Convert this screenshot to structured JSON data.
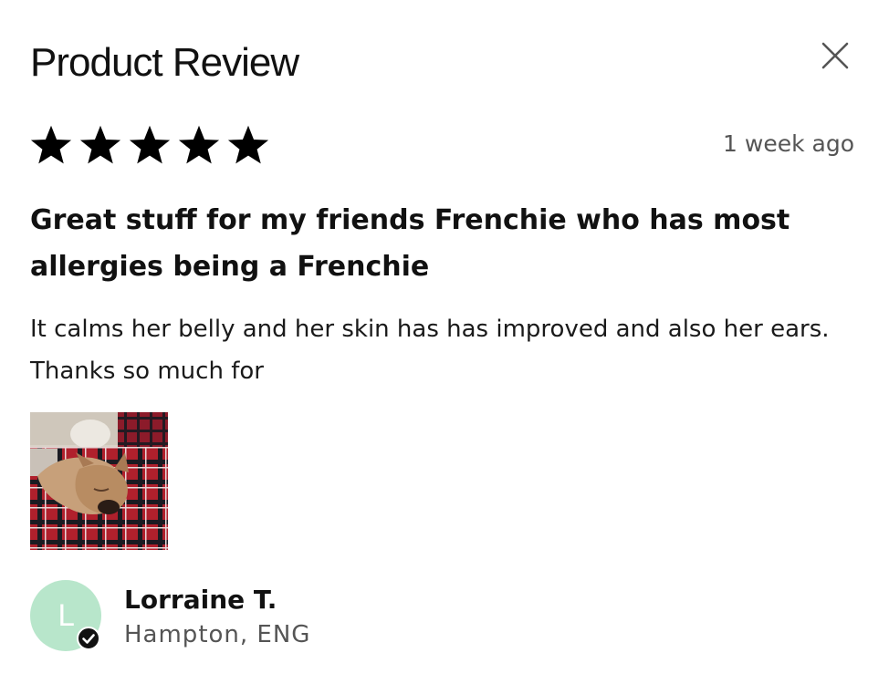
{
  "modal": {
    "title": "Product Review",
    "close_icon": "close-icon"
  },
  "review": {
    "rating": 5,
    "rating_max": 5,
    "star_icon": "star-icon",
    "timestamp": "1 week ago",
    "headline": "Great stuff for my friends Frenchie who has most allergies being a Frenchie",
    "body": "It calms her belly and her skin has has improved and also her ears. Thanks so much for",
    "photo_subject": "french bulldog sleeping on plaid blanket"
  },
  "reviewer": {
    "initial": "L",
    "name": "Lorraine T.",
    "location": "Hampton, ENG",
    "verified_icon": "verified-badge-icon",
    "avatar_color": "#b8e6cb"
  }
}
